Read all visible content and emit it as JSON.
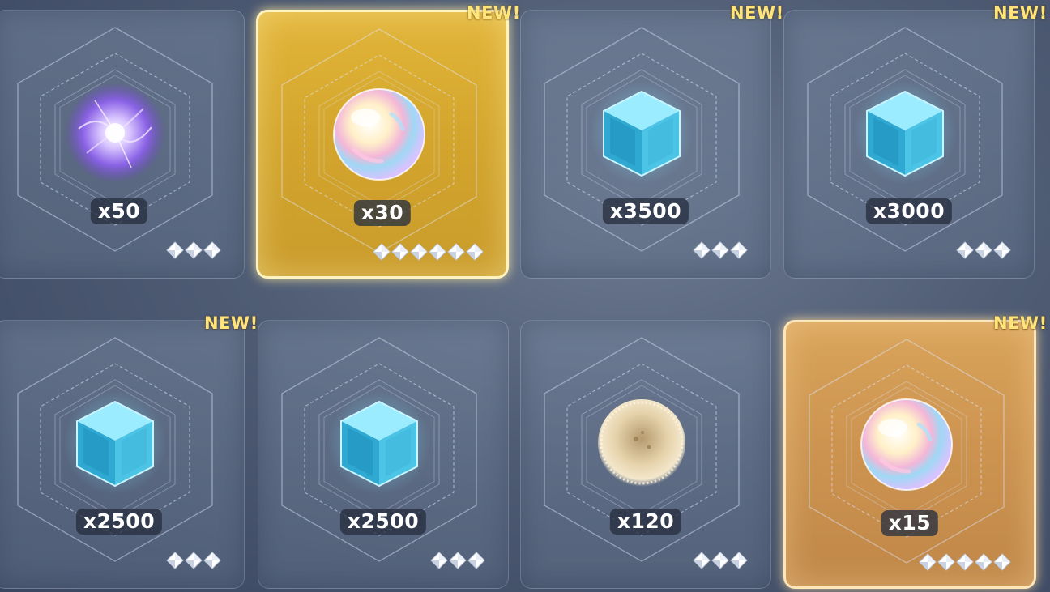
{
  "cards": [
    {
      "qty": "x50",
      "new": "",
      "rarity": 3,
      "style": "plain",
      "item": "purple-energy-orb-icon"
    },
    {
      "qty": "x30",
      "new": "NEW!",
      "rarity": 6,
      "style": "gold",
      "item": "prismatic-pearl-icon"
    },
    {
      "qty": "x3500",
      "new": "NEW!",
      "rarity": 3,
      "style": "plain",
      "item": "blue-cube-icon"
    },
    {
      "qty": "x3000",
      "new": "NEW!",
      "rarity": 3,
      "style": "plain",
      "item": "blue-cube-icon"
    },
    {
      "qty": "x2500",
      "new": "NEW!",
      "rarity": 3,
      "style": "plain",
      "item": "blue-cube-icon"
    },
    {
      "qty": "x2500",
      "new": "",
      "rarity": 3,
      "style": "plain",
      "item": "blue-cube-icon"
    },
    {
      "qty": "x120",
      "new": "",
      "rarity": 3,
      "style": "plain",
      "item": "golden-dust-orb-icon"
    },
    {
      "qty": "x15",
      "new": "NEW!",
      "rarity": 5,
      "style": "amber",
      "item": "prismatic-pearl-icon"
    }
  ],
  "colors": {
    "new_badge": "#ffe47a",
    "gold_card": "#d4a62d",
    "amber_card": "#cc9350",
    "plain_card": "#6e7c96"
  }
}
